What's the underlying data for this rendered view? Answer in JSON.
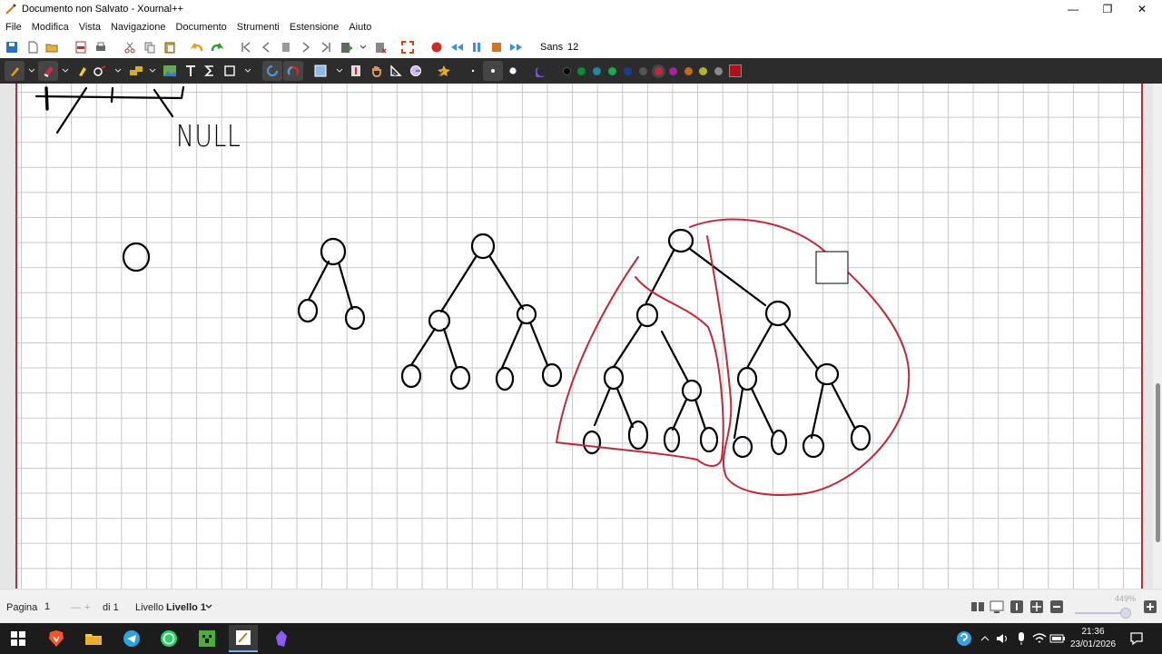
{
  "window": {
    "title": "Documento non Salvato - Xournal++",
    "minimize": "—",
    "maximize": "❐",
    "close": "✕"
  },
  "menu": [
    "File",
    "Modifica",
    "Vista",
    "Navigazione",
    "Documento",
    "Strumenti",
    "Estensione",
    "Aiuto"
  ],
  "toolbar": {
    "font_name": "Sans",
    "font_size": "12"
  },
  "colors": {
    "accent": "#c0293b",
    "grid": "#c8c8c8",
    "ink": "#000000",
    "palette": [
      "#000000",
      "#0a8a3a",
      "#1a8c9a",
      "#1fa84a",
      "#233a8c",
      "#555555",
      "#c0293b",
      "#a5249a",
      "#c06b1a",
      "#b4b42a",
      "#888888",
      "#b10f1a"
    ]
  },
  "canvas": {
    "text": "NULL"
  },
  "status": {
    "page_label": "Pagina",
    "page_value": "1",
    "page_total": "di 1",
    "layer_label": "Livello",
    "layer_value": "Livello 1",
    "zoom": "449%"
  },
  "taskbar": {
    "time": "21:36",
    "date": "23/01/2026"
  }
}
